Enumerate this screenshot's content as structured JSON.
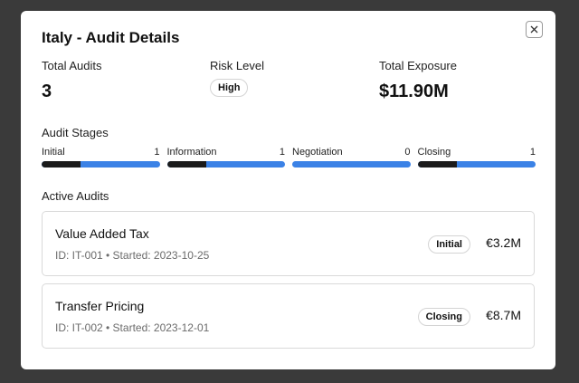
{
  "modal": {
    "title": "Italy - Audit Details",
    "close_icon": "close-icon"
  },
  "summary": {
    "total_audits_label": "Total Audits",
    "total_audits_value": "3",
    "risk_level_label": "Risk Level",
    "risk_level_value": "High",
    "total_exposure_label": "Total Exposure",
    "total_exposure_value": "$11.90M"
  },
  "stages": {
    "label": "Audit Stages",
    "items": [
      {
        "name": "Initial",
        "count": "1",
        "progress": 0.33
      },
      {
        "name": "Information",
        "count": "1",
        "progress": 0.33
      },
      {
        "name": "Negotiation",
        "count": "0",
        "progress": 0
      },
      {
        "name": "Closing",
        "count": "1",
        "progress": 0.33
      }
    ],
    "colors": {
      "track": "#3b82e6",
      "fill": "#1b1b1b"
    }
  },
  "active_audits": {
    "label": "Active Audits",
    "items": [
      {
        "name": "Value Added Tax",
        "meta": "ID: IT-001 • Started: 2023-10-25",
        "status": "Initial",
        "amount": "€3.2M"
      },
      {
        "name": "Transfer Pricing",
        "meta": "ID: IT-002 • Started: 2023-12-01",
        "status": "Closing",
        "amount": "€8.7M"
      }
    ]
  }
}
